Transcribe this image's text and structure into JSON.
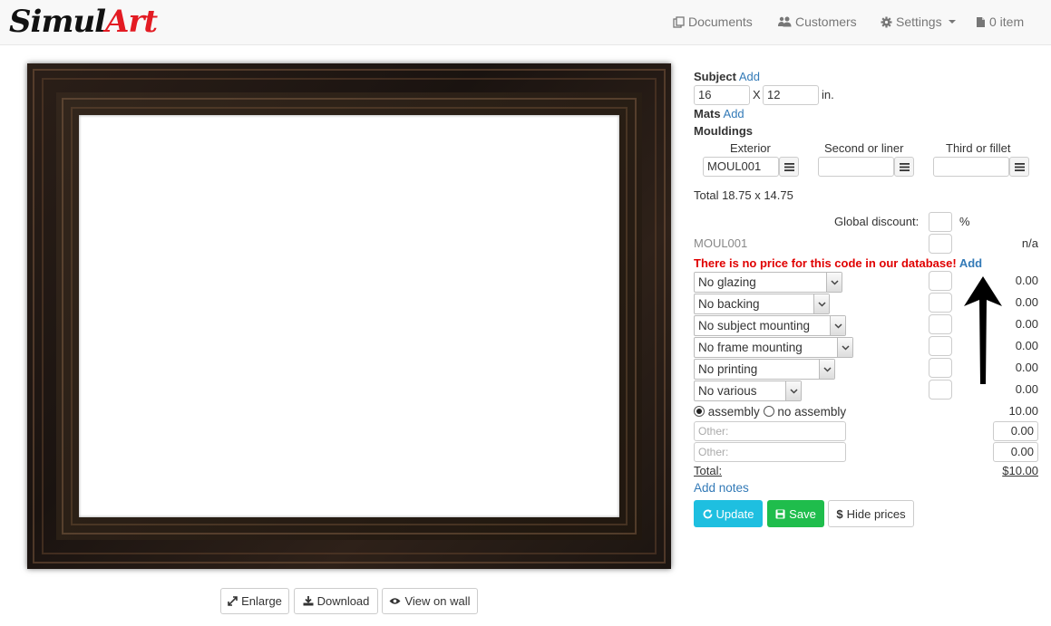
{
  "brand": {
    "part1": "Simul",
    "part2": "Art"
  },
  "nav": {
    "documents": "Documents",
    "customers": "Customers",
    "settings": "Settings",
    "cart": "0 item"
  },
  "image_actions": {
    "enlarge": "Enlarge",
    "download": "Download",
    "view_on_wall": "View on wall"
  },
  "subject": {
    "label": "Subject",
    "add": "Add",
    "width": "16",
    "height": "12",
    "x": "X",
    "unit": "in."
  },
  "mats": {
    "label": "Mats",
    "add": "Add"
  },
  "mouldings": {
    "label": "Mouldings",
    "exterior": {
      "label": "Exterior",
      "value": "MOUL001"
    },
    "second": {
      "label": "Second or liner",
      "value": ""
    },
    "third": {
      "label": "Third or fillet",
      "value": ""
    }
  },
  "total_size": "Total 18.75 x 14.75",
  "global_discount": {
    "label": "Global discount:",
    "unit": "%"
  },
  "moulding_line": {
    "code": "MOUL001",
    "price": "n/a"
  },
  "warning": {
    "text": "There is no price for this code in our database!",
    "add": "Add"
  },
  "options": [
    {
      "value": "No glazing",
      "price": "0.00"
    },
    {
      "value": "No backing",
      "price": "0.00"
    },
    {
      "value": "No subject mounting",
      "price": "0.00"
    },
    {
      "value": "No frame mounting",
      "price": "0.00"
    },
    {
      "value": "No printing",
      "price": "0.00"
    },
    {
      "value": "No various",
      "price": "0.00"
    }
  ],
  "assembly": {
    "on_label": "assembly",
    "off_label": "no assembly",
    "price": "10.00"
  },
  "other": [
    {
      "placeholder": "Other:",
      "price": "0.00"
    },
    {
      "placeholder": "Other:",
      "price": "0.00"
    }
  ],
  "total": {
    "label": "Total:",
    "value": "$10.00"
  },
  "add_notes": "Add notes",
  "buttons": {
    "update": "Update",
    "save": "Save",
    "hide_prices": "Hide prices"
  },
  "colors": {
    "update": "#1ebfe0",
    "save": "#1fbd4c",
    "warning": "#e00000",
    "link": "#337ab7"
  }
}
